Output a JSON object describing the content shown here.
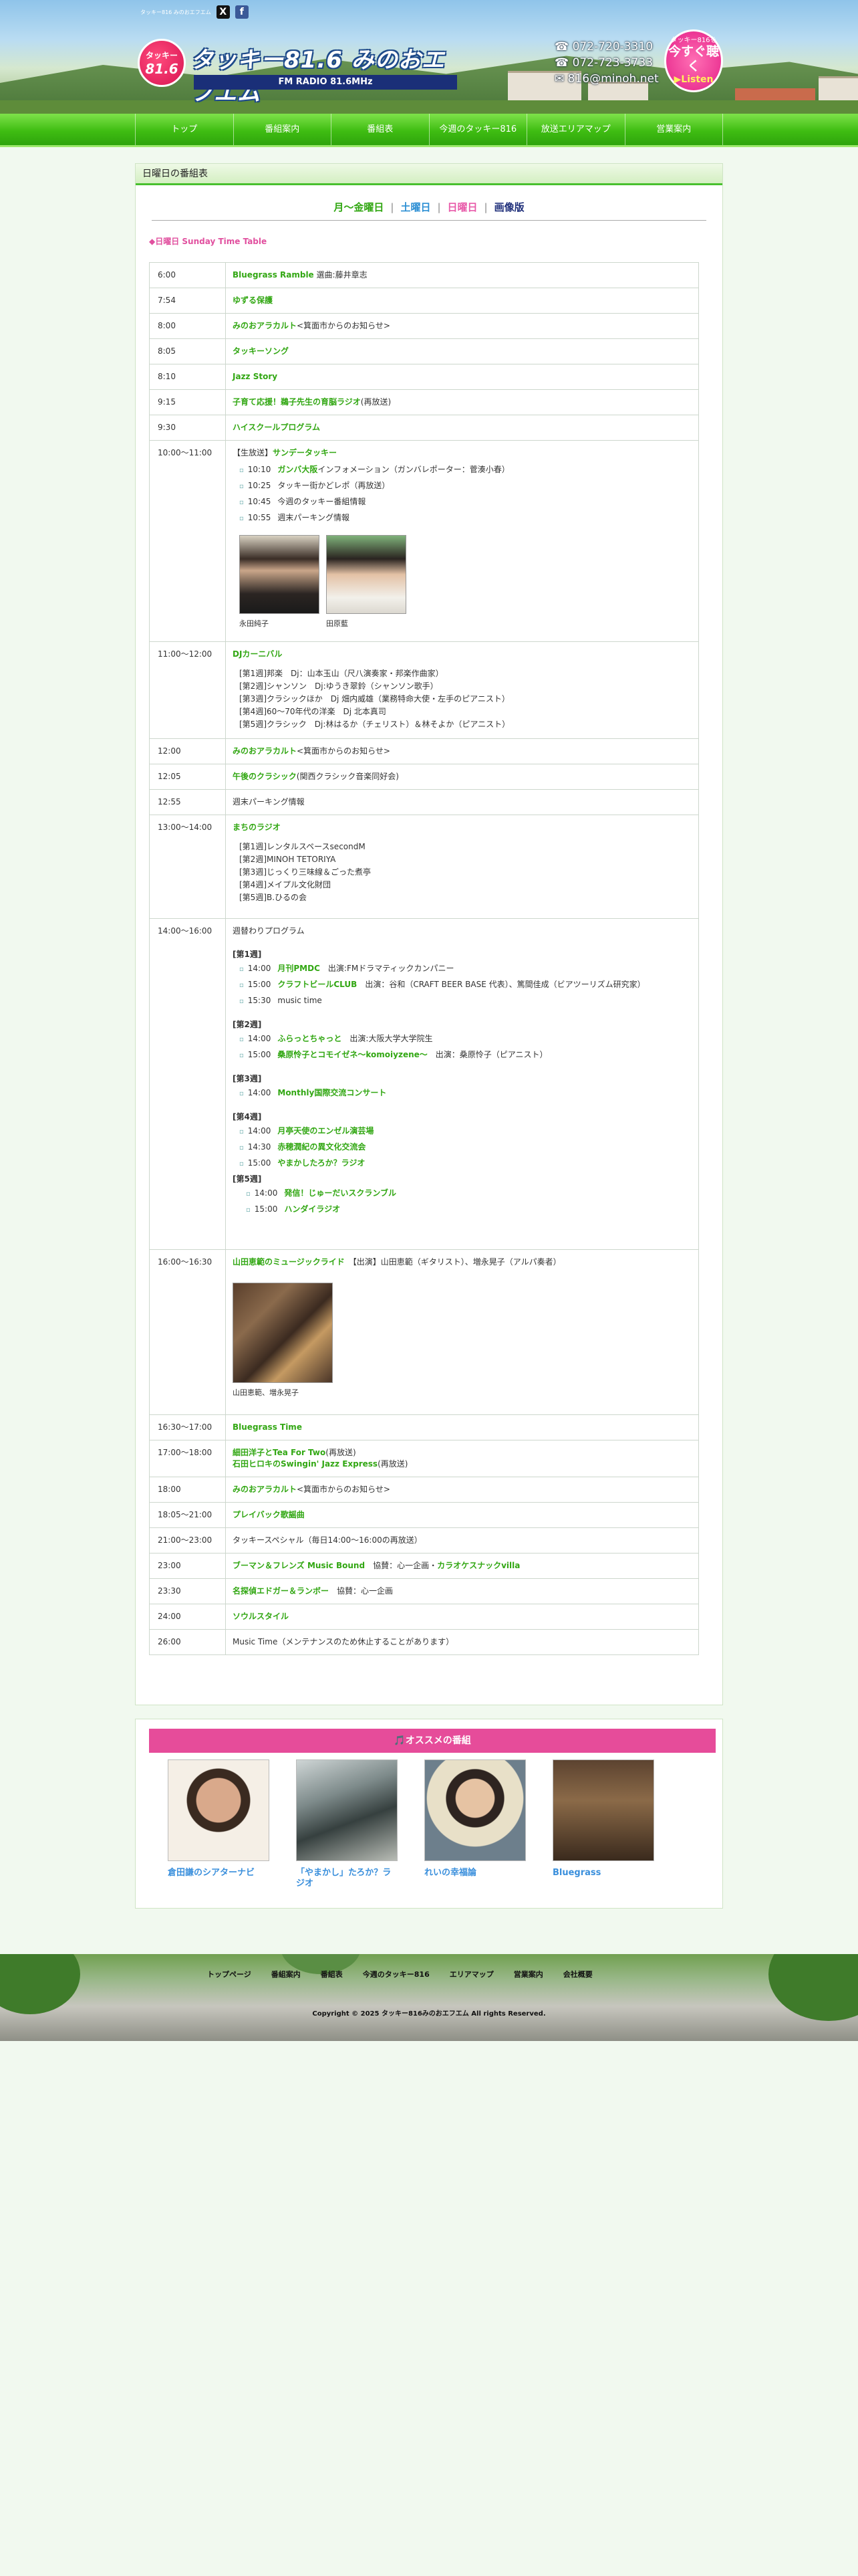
{
  "header": {
    "tagline": "タッキー816 みのおエフエム",
    "social": [
      "X",
      "f"
    ],
    "logo_line1": "タッキー",
    "logo_line2": "81.6",
    "station_name": "タッキー81.6 みのおエフエム",
    "frequency": "FM RADIO 81.6MHz",
    "phone1": "☎ 072-720-3310",
    "phone2": "☎ 072-723-3733",
    "email": "✉ 816@minoh.net",
    "listen_small": "タッキー816を",
    "listen_big": "今すぐ聴く",
    "listen_en": "▶Listen"
  },
  "nav": [
    "トップ",
    "番組案内",
    "番組表",
    "今週のタッキー816",
    "放送エリアマップ",
    "営業案内"
  ],
  "main": {
    "heading": "日曜日の番組表",
    "day_links": [
      {
        "label": "月〜金曜日",
        "color": "#32a713"
      },
      {
        "label": "土曜日",
        "color": "#2d8fd4"
      },
      {
        "label": "日曜日",
        "color": "#e85aa9"
      },
      {
        "label": "画像版",
        "color": "#1f2f7a"
      }
    ],
    "subtitle": "◆日曜日 Sunday Time Table",
    "schedule": [
      {
        "time": "6:00",
        "title": "Bluegrass Ramble",
        "note": "選曲:藤井章志"
      },
      {
        "time": "7:54",
        "title": "ゆずる保護",
        "note": ""
      },
      {
        "time": "8:00",
        "title": "みのおアラカルト",
        "note": "<箕面市からのお知らせ>"
      },
      {
        "time": "8:05",
        "title": "タッキーソング",
        "note": ""
      },
      {
        "time": "8:10",
        "title": "Jazz Story",
        "note": ""
      },
      {
        "time": "9:15",
        "title": "子育て応援！鵜子先生の育脳ラジオ",
        "note": "(再放送)"
      },
      {
        "time": "9:30",
        "title": "ハイスクールプログラム",
        "note": ""
      }
    ],
    "sunday_tacky": {
      "time": "10:00〜11:00",
      "prefix": "【生放送】",
      "title": "サンデータッキー",
      "items": [
        {
          "t": "10:10",
          "hl": "ガンバ大阪",
          "text": "インフォメーション（ガンバレポーター：菅湊小春）"
        },
        {
          "t": "10:25",
          "hl": "",
          "text": "タッキー街かどレポ（再放送）"
        },
        {
          "t": "10:45",
          "hl": "",
          "text": "今週のタッキー番組情報"
        },
        {
          "t": "10:55",
          "hl": "",
          "text": "週末パーキング情報"
        }
      ],
      "photos": [
        "永田純子",
        "田原藍"
      ]
    },
    "dj_carnival": {
      "time": "11:00〜12:00",
      "title": "DJカーニバル",
      "lines": [
        "[第1週]邦楽　Dj：山本玉山（尺八演奏家・邦楽作曲家）",
        "[第2週]シャンソン　Dj:ゆうき翠鈴（シャンソン歌手）",
        "[第3週]クラシックほか　Dj 畑内威雄（業務特命大使・左手のピアニスト）",
        "[第4週]60〜70年代の洋楽　Dj 北本真司",
        "[第5週]クラシック　Dj:林はるか（チェリスト）＆林そよか（ピアニスト）"
      ]
    },
    "schedule2": [
      {
        "time": "12:00",
        "title": "みのおアラカルト",
        "note": "<箕面市からのお知らせ>"
      },
      {
        "time": "12:05",
        "title": "午後のクラシック",
        "note": "(関西クラシック音楽同好会)"
      },
      {
        "time": "12:55",
        "title": "",
        "note": "週末パーキング情報"
      }
    ],
    "machi_radio": {
      "time": "13:00〜14:00",
      "title": "まちのラジオ",
      "lines": [
        "[第1週]レンタルスペースsecondM",
        "[第2週]MINOH TETORIYA",
        "[第3週]じっくり三味線＆ごった煮亭",
        "[第4週]メイプル文化財団",
        "[第5週]B.ひるの会"
      ]
    },
    "weekly": {
      "time": "14:00〜16:00",
      "heading": "週替わりプログラム",
      "weeks": [
        {
          "label": "[第1週]",
          "items": [
            {
              "t": "14:00",
              "hl": "月刊PMDC",
              "text": "出演:FMドラマティックカンパニー"
            },
            {
              "t": "15:00",
              "hl": "クラフトビールCLUB",
              "text": "出演：谷和（CRAFT BEER BASE 代表）、篤間佳成（ビアツーリズム研究家）"
            },
            {
              "t": "15:30",
              "hl": "",
              "text": "music time"
            }
          ]
        },
        {
          "label": "[第2週]",
          "items": [
            {
              "t": "14:00",
              "hl": "ふらっとちゃっと",
              "text": "出演:大阪大学大学院生"
            },
            {
              "t": "15:00",
              "hl": "桑原怜子とコモイゼネ〜komoiyzene〜",
              "text": "出演：桑原怜子（ピアニスト）"
            }
          ]
        },
        {
          "label": "[第3週]",
          "items": [
            {
              "t": "14:00",
              "hl": "Monthly国際交流コンサート",
              "text": ""
            }
          ]
        },
        {
          "label": "[第4週]",
          "items": [
            {
              "t": "14:00",
              "hl": "月亭天使のエンゼル演芸場",
              "text": ""
            },
            {
              "t": "14:30",
              "hl": "赤穂潤紀の異文化交流会",
              "text": ""
            },
            {
              "t": "15:00",
              "hl": "やまかしたろか？ラジオ",
              "text": ""
            }
          ]
        },
        {
          "label": "[第5週]",
          "items": [
            {
              "t": "14:00",
              "hl": "発信！じゅーだいスクランブル",
              "text": ""
            },
            {
              "t": "15:00",
              "hl": "ハンダイラジオ",
              "text": ""
            }
          ]
        }
      ]
    },
    "music_ride": {
      "time": "16:00〜16:30",
      "title": "山田恵範のミュージックライド",
      "note": "【出演】山田恵範（ギタリスト）、増永晃子（アルパ奏者）",
      "caption": "山田恵範、増永晃子"
    },
    "schedule3": [
      {
        "time": "16:30〜17:00",
        "title": "Bluegrass Time",
        "note": ""
      }
    ],
    "tea": {
      "time": "17:00〜18:00",
      "line1_title": "細田洋子とTea For Two",
      "line1_note": "(再放送)",
      "line2_title": "石田ヒロキのSwingin' Jazz Express",
      "line2_note": "(再放送)"
    },
    "schedule4": [
      {
        "time": "18:00",
        "title": "みのおアラカルト",
        "note": "<箕面市からのお知らせ>"
      },
      {
        "time": "18:05〜21:00",
        "title": "プレイバック歌謡曲",
        "note": ""
      },
      {
        "time": "21:00〜23:00",
        "title": "",
        "note": "タッキースペシャル（毎日14:00〜16:00の再放送）"
      }
    ],
    "buman": {
      "time": "23:00",
      "title": "ブーマン＆フレンズ Music Bound",
      "mid": "協賛：心一企画・",
      "title2": "カラオケスナックvilla"
    },
    "schedule5": [
      {
        "time": "23:30",
        "title": "名探偵エドガー＆ランボー",
        "note": "協賛：心一企画"
      },
      {
        "time": "24:00",
        "title": "ソウルスタイル",
        "note": ""
      },
      {
        "time": "26:00",
        "title": "",
        "note": "Music Time（メンテナンスのため休止することがあります）"
      }
    ]
  },
  "recommend": {
    "heading": "🎵オススメの番組",
    "items": [
      {
        "title": "倉田謙のシアターナビ",
        "bg": "#e8d8c8"
      },
      {
        "title": "「やまかし」たろか？ラジオ",
        "bg": "#9aa5a5"
      },
      {
        "title": "れいの幸福論",
        "bg": "#d9c9a0"
      },
      {
        "title": "Bluegrass",
        "bg": "#7b5a3a"
      }
    ]
  },
  "footer": {
    "links": [
      "トップページ",
      "番組案内",
      "番組表",
      "今週のタッキー816",
      "エリアマップ",
      "営業案内",
      "会社概要"
    ],
    "copyright": "Copyright © 2025 タッキー816みのおエフエム All rights Reserved."
  }
}
